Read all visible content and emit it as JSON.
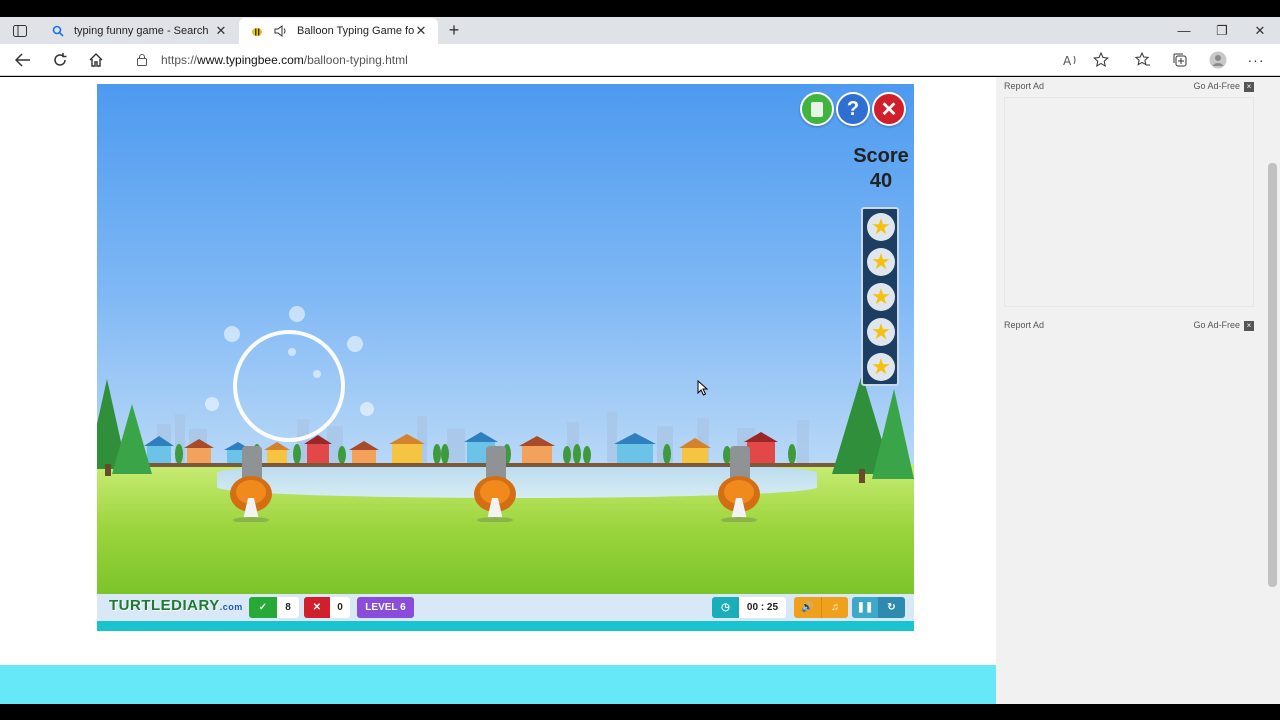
{
  "browser": {
    "tabs": [
      {
        "title": "typing funny game - Search",
        "icon": "search-icon"
      },
      {
        "title": "Balloon Typing Game for Ki",
        "icon": "bee-favicon"
      }
    ],
    "url_prefix": "https://",
    "url_host": "www.typingbee.com",
    "url_path": "/balloon-typing.html"
  },
  "ads": {
    "report_label": "Report Ad",
    "adfree_label": "Go Ad-Free",
    "close_glyph": "×"
  },
  "game": {
    "score_label": "Score",
    "score_value": "40",
    "stars": 5,
    "logo_text": "TURTLEDIARY",
    "logo_suffix": ".com",
    "correct_count": "8",
    "wrong_count": "0",
    "level_label": "LEVEL 6",
    "timer": "00 : 25",
    "colors": {
      "correct": "#27a935",
      "wrong": "#d0202b",
      "level": "#8a4ddb",
      "timer": "#19aeb8",
      "sound": "#f0a11b",
      "control": "#3fa7c9"
    }
  }
}
